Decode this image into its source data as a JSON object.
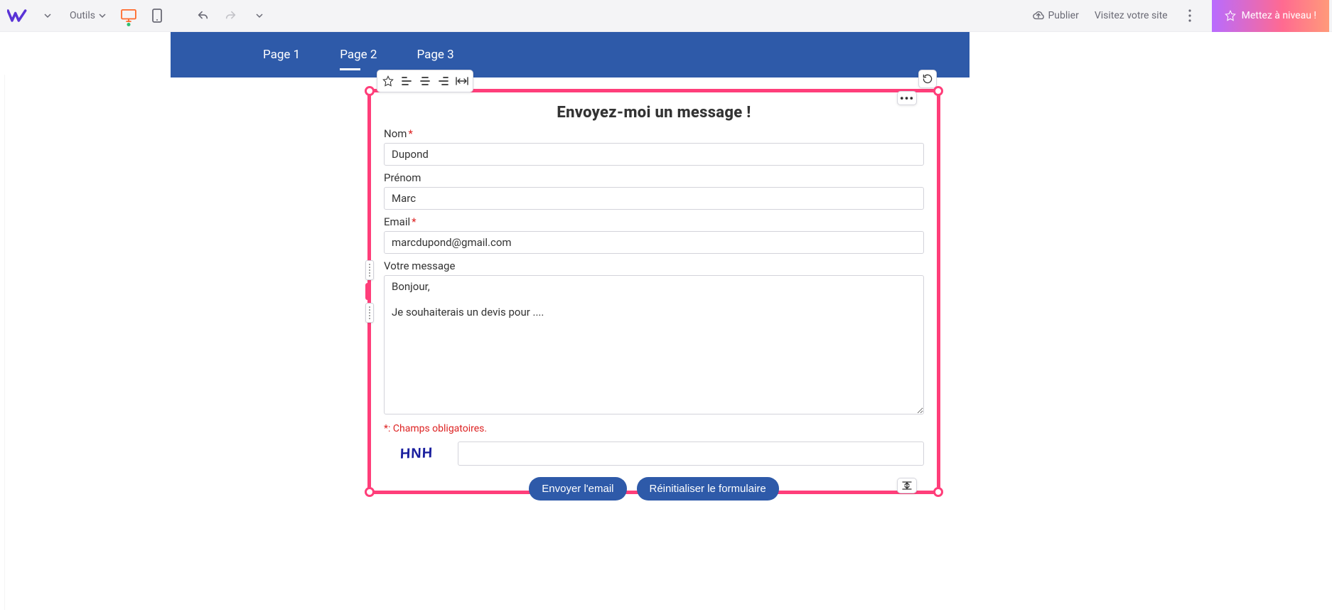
{
  "topbar": {
    "tools_label": "Outils",
    "publish_label": "Publier",
    "visit_label": "Visitez votre site",
    "upgrade_label": "Mettez à niveau !"
  },
  "nav": {
    "items": [
      "Page 1",
      "Page 2",
      "Page 3"
    ],
    "active_index": 1
  },
  "form": {
    "title": "Envoyez-moi un message !",
    "fields": {
      "nom": {
        "label": "Nom",
        "required": true,
        "value": "Dupond"
      },
      "prenom": {
        "label": "Prénom",
        "required": false,
        "value": "Marc"
      },
      "email": {
        "label": "Email",
        "required": true,
        "value": "marcdupond@gmail.com"
      },
      "message": {
        "label": "Votre message",
        "required": false,
        "value": "Bonjour,\n\nJe souhaiterais un devis pour ...."
      }
    },
    "mandatory_note": "*: Champs obligatoires.",
    "captcha_text": "HNH",
    "submit_label": "Envoyer l'email",
    "reset_label": "Réinitialiser le formulaire"
  }
}
